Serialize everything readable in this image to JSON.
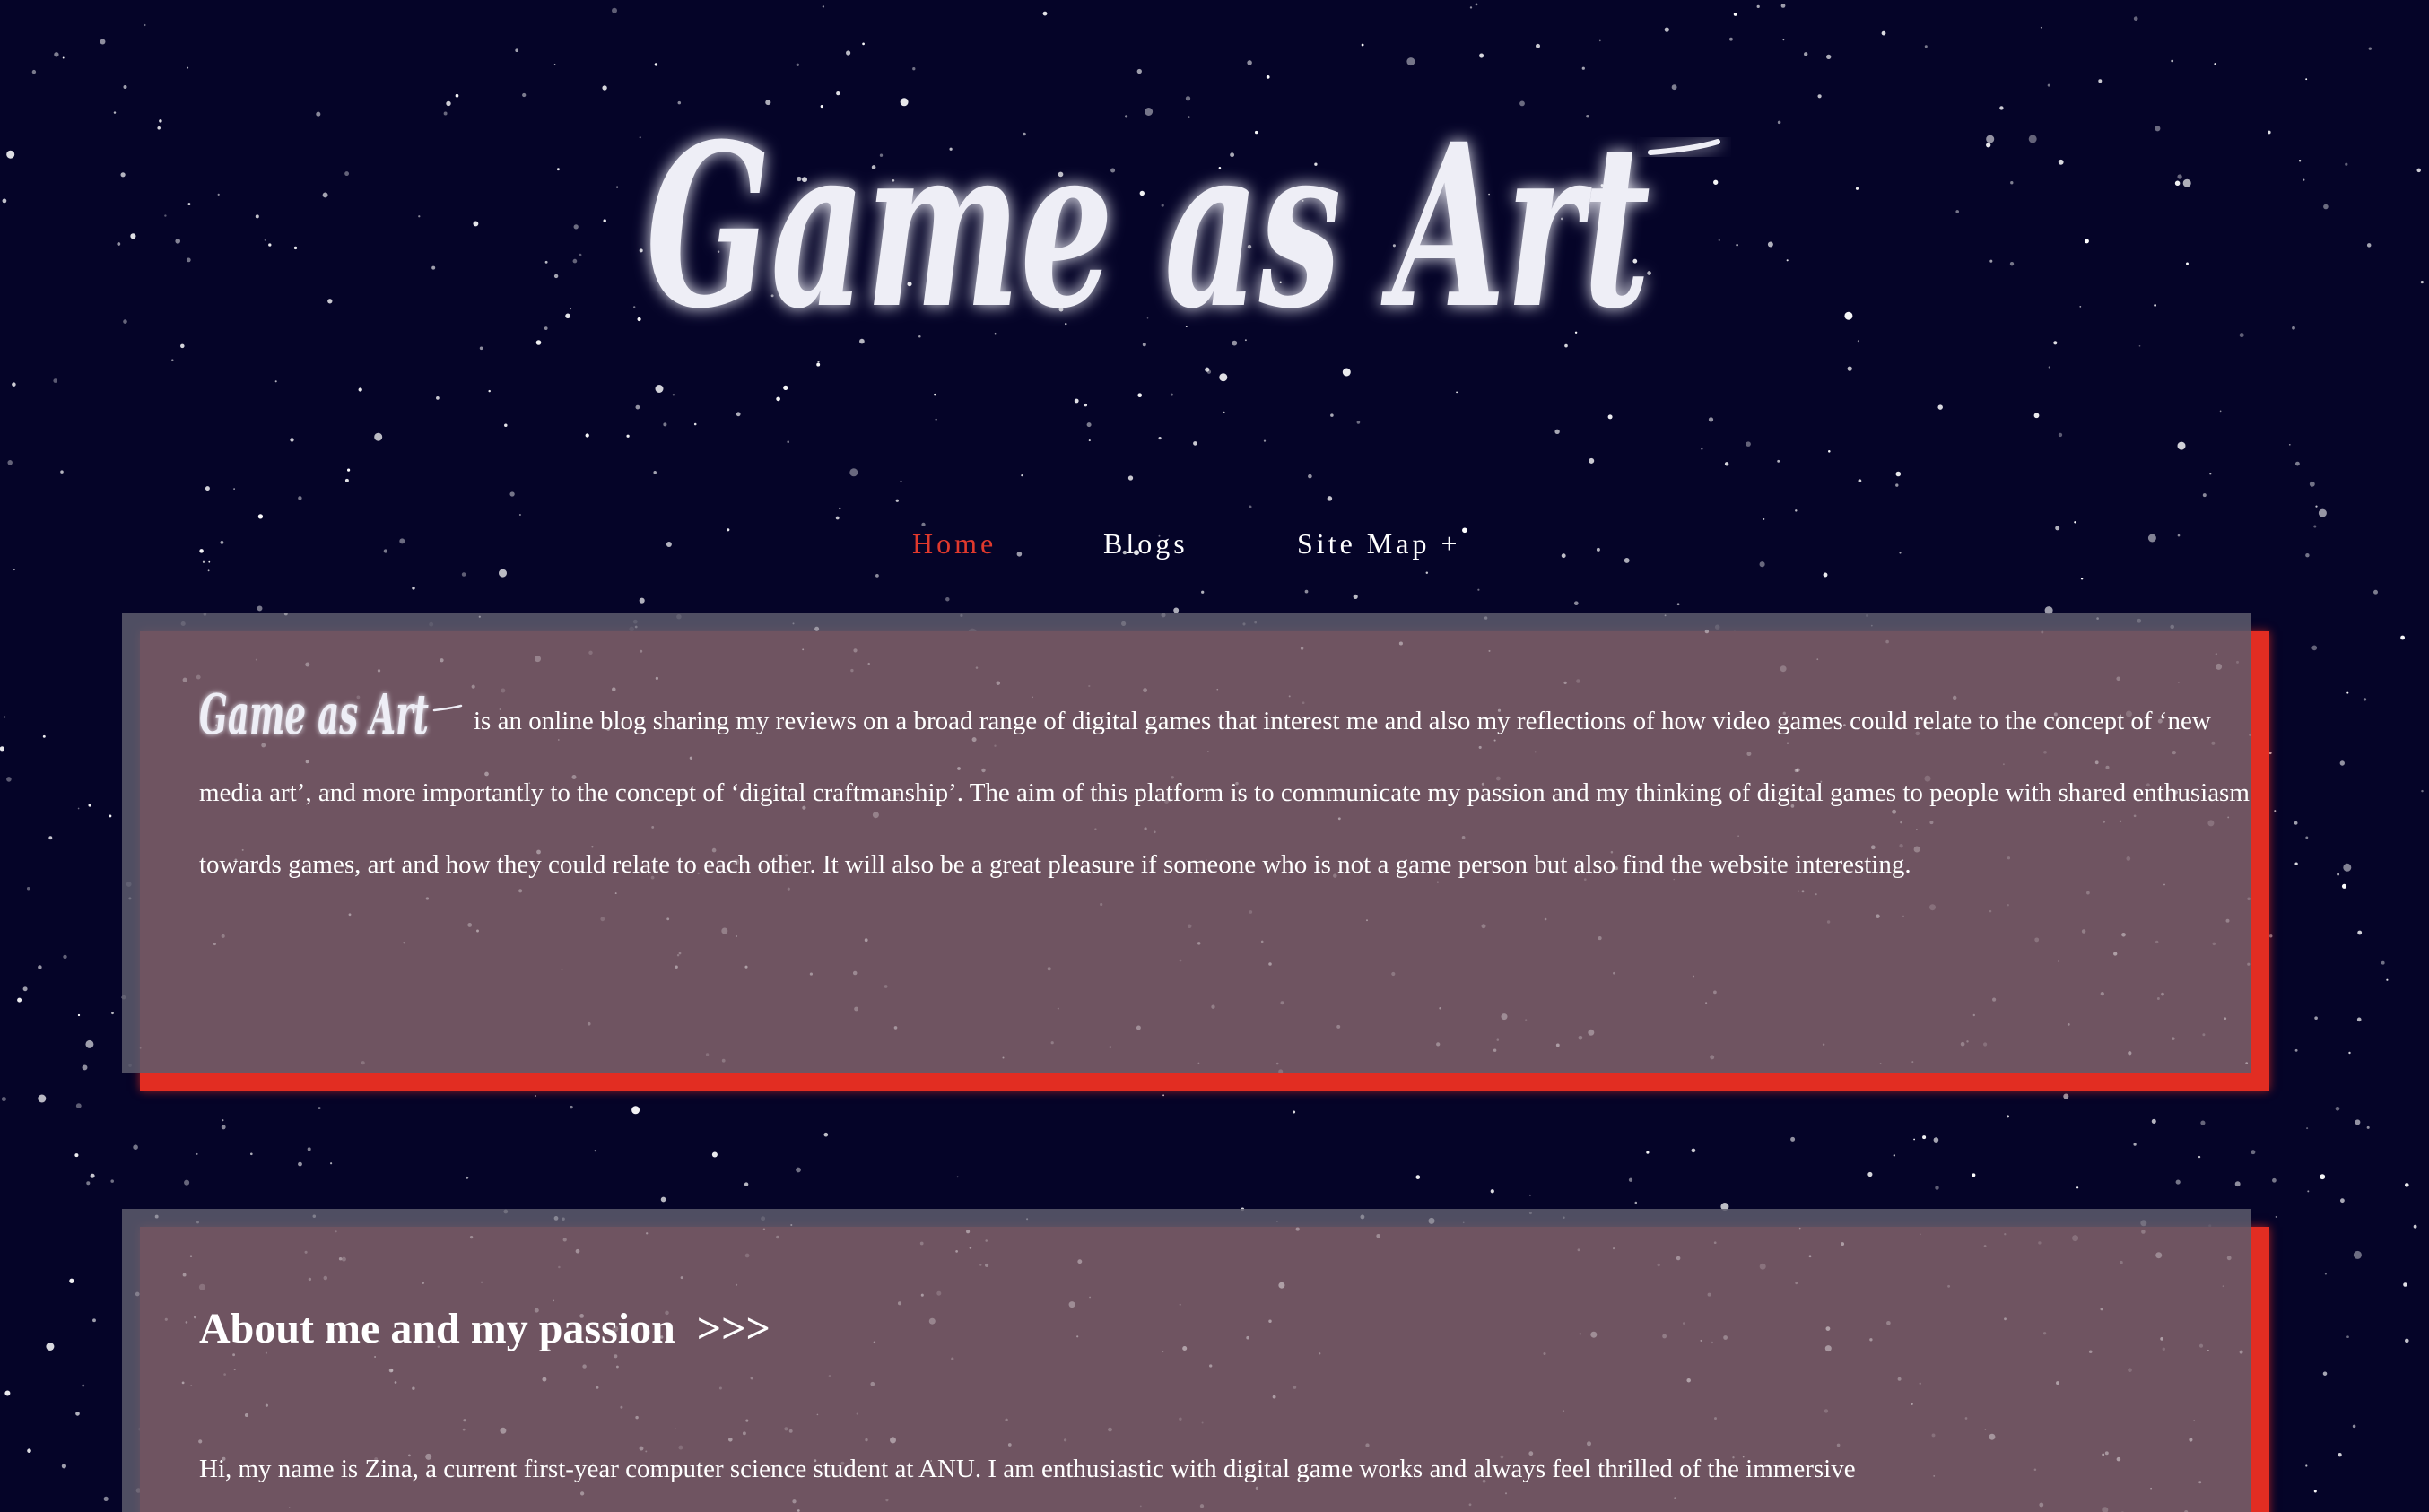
{
  "site": {
    "logo_text": "Game as Art",
    "colors": {
      "background": "#050428",
      "card": "#5c5b6c",
      "accent": "#e22d22",
      "active_nav": "#e0392d",
      "text": "#ffffff"
    }
  },
  "nav": {
    "items": [
      {
        "label": "Home",
        "active": true
      },
      {
        "label": "Blogs",
        "active": false
      },
      {
        "label": "Site Map +",
        "active": false
      }
    ]
  },
  "intro": {
    "logo_text": "Game as Art",
    "text": "is an online blog sharing my reviews on a broad range of digital games that interest me and also my reflections of how video games could relate to the concept of ‘new media art’, and more importantly to the concept of ‘digital craftmanship’. The aim of this platform is to communicate my passion and my thinking of digital games to people with shared enthusiasms towards games, art and how they could relate to each other. It will also be a great pleasure if someone who is not a game person but also find the website interesting."
  },
  "about": {
    "heading": "About me and my passion",
    "arrows": ">>>",
    "text": "Hi, my name is Zina, a current first-year computer science student at ANU. I am enthusiastic with digital game works and always feel thrilled of the immersive"
  }
}
